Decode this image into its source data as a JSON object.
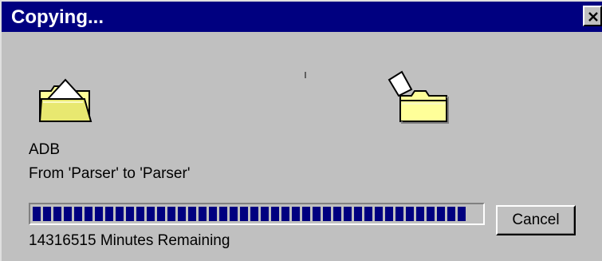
{
  "window": {
    "title": "Copying..."
  },
  "icons": {
    "source": "open-folder-icon",
    "destination": "folder-with-paper-icon",
    "close": "close-x-icon"
  },
  "operation": {
    "file_name": "ADB",
    "from_to": "From 'Parser' to 'Parser'",
    "time_remaining": "14316515 Minutes Remaining",
    "progress_fraction": 0.98
  },
  "buttons": {
    "cancel_label": "Cancel"
  },
  "colors": {
    "titlebar": "#000080",
    "progress_block": "#000080",
    "face": "#c0c0c0",
    "folder_yellow": "#ffff99"
  }
}
